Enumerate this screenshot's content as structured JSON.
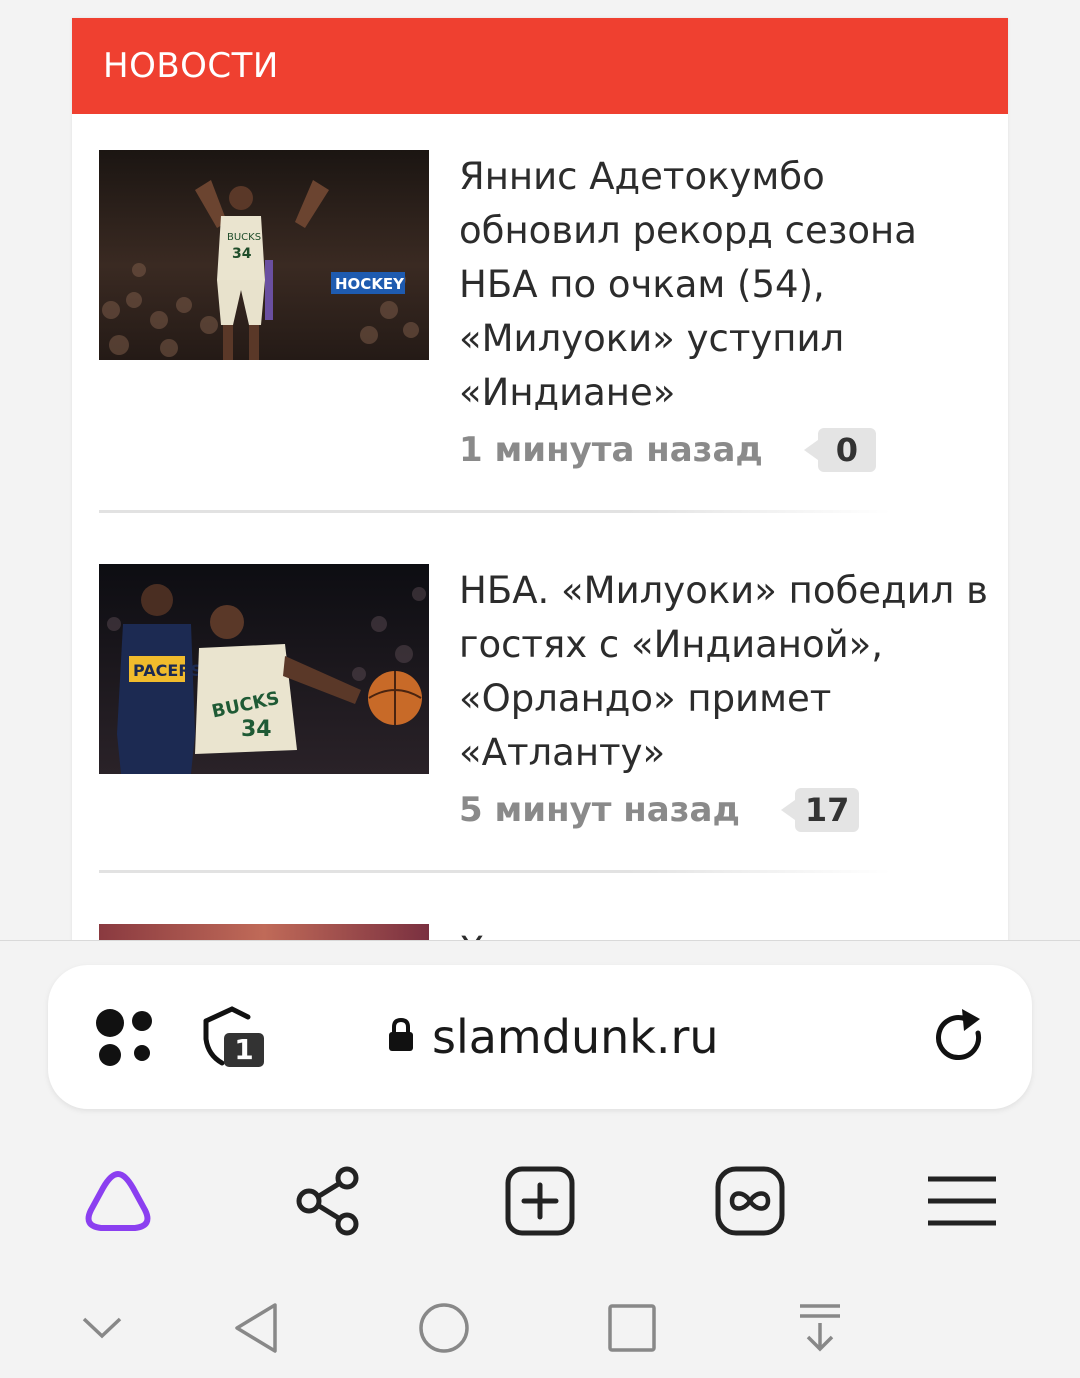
{
  "section": {
    "title": "НОВОСТИ",
    "accent": "#ef4030"
  },
  "news": [
    {
      "title": "Яннис Адетокумбо обновил рекорд сезона НБА по очкам (54), «Милуоки» уступил «Индиане»",
      "time": "1 минута назад",
      "comments": "0",
      "thumb_text": [
        "BUCKS",
        "34",
        "HOCKEY"
      ]
    },
    {
      "title": "НБА. «Милуоки» победил в гостях с «Индианой», «Орландо» примет «Атланту»",
      "time": "5 минут назад",
      "comments": "17",
      "thumb_text": [
        "PACERS",
        "BUCKS",
        "34"
      ]
    },
    {
      "title": "Х"
    }
  ],
  "browser": {
    "url": "slamdunk.ru",
    "tab_count": "1",
    "icons": {
      "services": "dots-grid-icon",
      "protect": "shield-icon",
      "secure": "lock-icon",
      "reload": "reload-icon"
    },
    "toolbar": [
      "alice-icon",
      "share-icon",
      "new-tab-icon",
      "tabs-infinity-icon",
      "menu-icon"
    ],
    "alice_color": "#8b3ff0"
  },
  "system_nav": [
    "collapse-icon",
    "back-icon",
    "home-icon",
    "recents-icon",
    "download-icon"
  ]
}
